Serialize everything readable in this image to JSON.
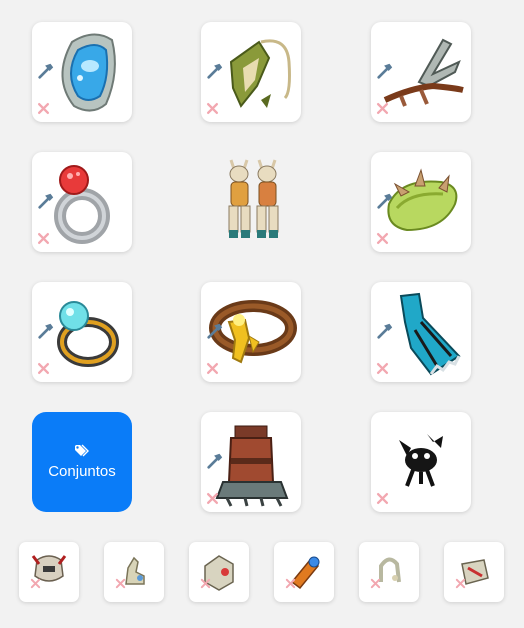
{
  "equipment": {
    "slots": [
      {
        "item": "shield-icon"
      },
      {
        "item": "amulet-icon"
      },
      {
        "item": "weapon-icon"
      },
      {
        "item": "ring-icon"
      },
      {
        "item": "character-portrait"
      },
      {
        "item": "belt-icon"
      },
      {
        "item": "ring-icon"
      },
      {
        "item": "belt-icon"
      },
      {
        "item": "cape-icon"
      },
      {
        "item": "boots-icon"
      },
      {
        "item": "pet-icon"
      }
    ],
    "dofus_slots": [
      {
        "item": "helmet-icon"
      },
      {
        "item": "mount-icon"
      },
      {
        "item": "trophy-icon"
      },
      {
        "item": "trophy-icon"
      },
      {
        "item": "trophy-icon"
      },
      {
        "item": "trophy-icon"
      }
    ]
  },
  "sets_button": {
    "label": "Conjuntos",
    "icon": "tags-icon",
    "color": "#0a7cf8"
  },
  "colors": {
    "hammer": "#5a7c98",
    "remove": "#f2a7b0",
    "background": "#f2f2f2"
  }
}
